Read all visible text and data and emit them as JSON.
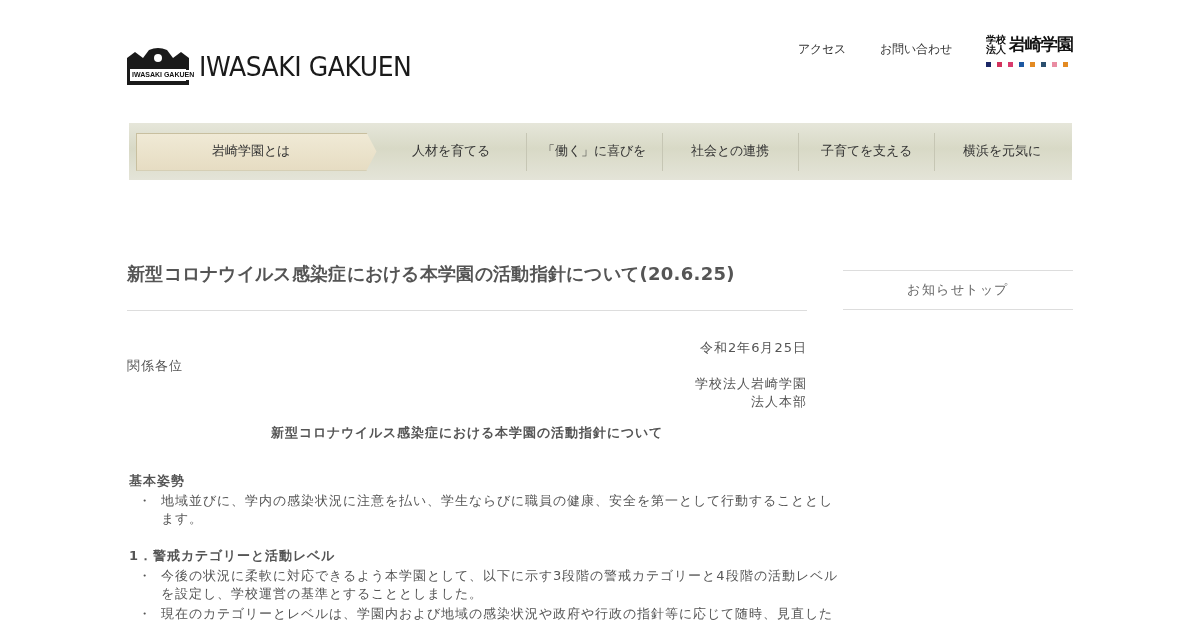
{
  "header": {
    "logo_mark_text": "IWASAKI GAKUEN",
    "logo_text": "IWASAKI GAKUEN",
    "links": [
      "アクセス",
      "お問い合わせ"
    ],
    "corp_logo": {
      "prefix_top": "学校",
      "prefix_bottom": "法人",
      "name": "岩崎学園",
      "dots": [
        {
          "color": "#1b2766"
        },
        {
          "color": "#d2325c"
        },
        {
          "color": "#d93c6e"
        },
        {
          "color": "#1c58a2"
        },
        {
          "color": "#e38a22"
        },
        {
          "color": "#2b4f6e"
        },
        {
          "color": "#e98ca2"
        },
        {
          "color": "#e38a22"
        }
      ]
    }
  },
  "nav": [
    {
      "label": "岩崎学園とは",
      "selected": true
    },
    {
      "label": "人材を育てる",
      "selected": false
    },
    {
      "label": "「働く」に喜びを",
      "selected": false
    },
    {
      "label": "社会との連携",
      "selected": false
    },
    {
      "label": "子育てを支える",
      "selected": false
    },
    {
      "label": "横浜を元気に",
      "selected": false
    }
  ],
  "article": {
    "title": "新型コロナウイルス感染症における本学園の活動指針について(20.6.25)",
    "date": "令和2年6月25日",
    "addressee": "関係各位",
    "sender": [
      "学校法人岩崎学園",
      "法人本部"
    ],
    "heading": "新型コロナウイルス感染症における本学園の活動指針について",
    "sections": [
      {
        "heading": "基本姿勢",
        "bullets": [
          {
            "mark": "・",
            "text": "地域並びに、学内の感染状況に注意を払い、学生ならびに職員の健康、安全を第一として行動することとします。"
          }
        ]
      },
      {
        "heading": "1．警戒カテゴリーと活動レベル",
        "bullets": [
          {
            "mark": "・",
            "text": "今後の状況に柔軟に対応できるよう本学園として、以下に示す3段階の警戒カテゴリーと4段階の活動レベルを設定し、学校運営の基準とすることとしました。"
          },
          {
            "mark": "・",
            "text": "現在のカテゴリーとレベルは、学園内および地域の感染状況や政府や行政の指針等に応じて随時、見直した"
          }
        ]
      }
    ]
  },
  "sidebar": {
    "links": [
      "お知らせトップ"
    ]
  }
}
